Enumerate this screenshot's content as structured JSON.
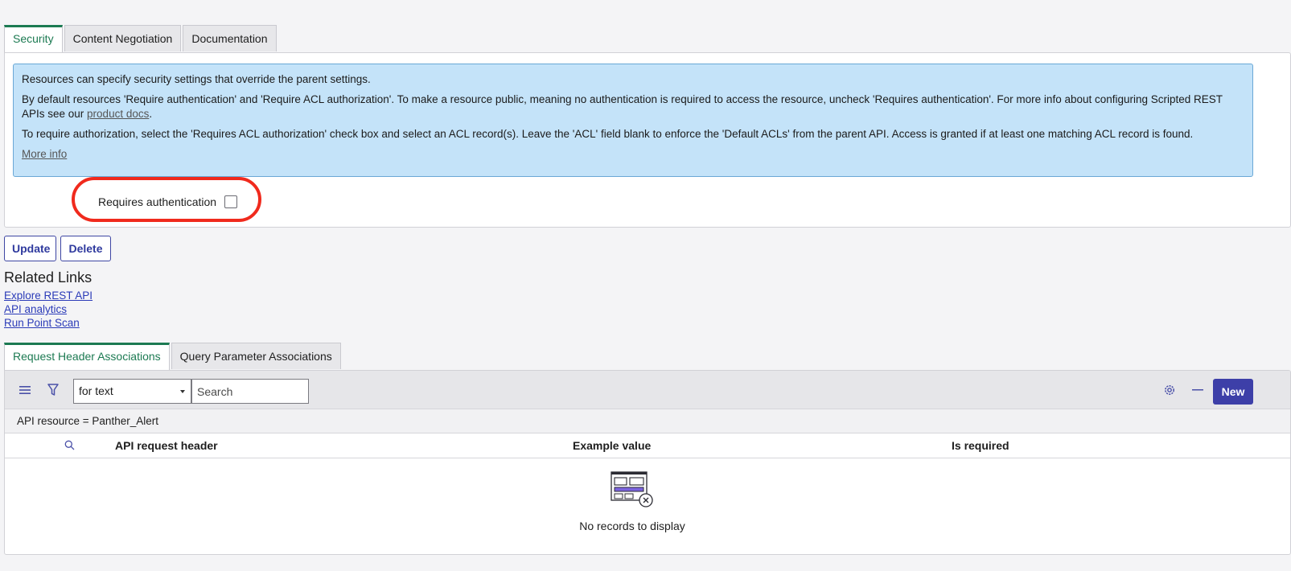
{
  "top_tabs": [
    "Security",
    "Content Negotiation",
    "Documentation"
  ],
  "info": {
    "line1": "Resources can specify security settings that override the parent settings.",
    "line2_prefix": "By default resources 'Require authentication' and 'Require ACL authorization'. To make a resource public, meaning no authentication is required to access the resource, uncheck 'Requires authentication'. For more info about configuring Scripted REST APIs see our ",
    "line2_link": "product docs",
    "line2_suffix": ".",
    "line3": "To require authorization, select the 'Requires ACL authorization' check box and select an ACL record(s). Leave the 'ACL' field blank to enforce the 'Default ACLs' from the parent API. Access is granted if at least one matching ACL record is found.",
    "more_info": "More info"
  },
  "auth": {
    "label": "Requires authentication",
    "checked": false
  },
  "buttons": {
    "update": "Update",
    "delete": "Delete"
  },
  "related": {
    "title": "Related Links",
    "links": [
      "Explore REST API",
      "API analytics",
      "Run Point Scan"
    ]
  },
  "list_tabs": [
    "Request Header Associations",
    "Query Parameter Associations"
  ],
  "toolbar": {
    "select_value": "for text",
    "search_placeholder": "Search",
    "new_label": "New"
  },
  "filter": "API resource = Panther_Alert",
  "columns": [
    "API request header",
    "Example value",
    "Is required"
  ],
  "empty_text": "No records to display",
  "colors": {
    "accent_green": "#1c7a52",
    "primary_button": "#3d3fa8",
    "info_bg": "#c4e3f9",
    "highlight": "#f02a1d"
  }
}
